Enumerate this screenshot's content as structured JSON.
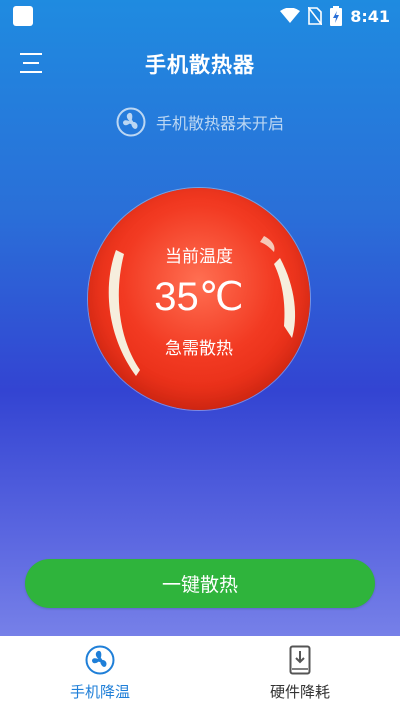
{
  "status_bar": {
    "time": "8:41"
  },
  "header": {
    "title": "手机散热器"
  },
  "fan_status": {
    "text": "手机散热器未开启"
  },
  "temperature": {
    "label": "当前温度",
    "value": "35℃",
    "status": "急需散热"
  },
  "action": {
    "label": "一键散热"
  },
  "tabs": [
    {
      "label": "手机降温",
      "icon": "fan-icon",
      "active": true
    },
    {
      "label": "硬件降耗",
      "icon": "phone-download-icon",
      "active": false
    }
  ],
  "colors": {
    "button": "#2fb43c",
    "orb": "#f23a22",
    "active_tab": "#1f7fd8"
  }
}
